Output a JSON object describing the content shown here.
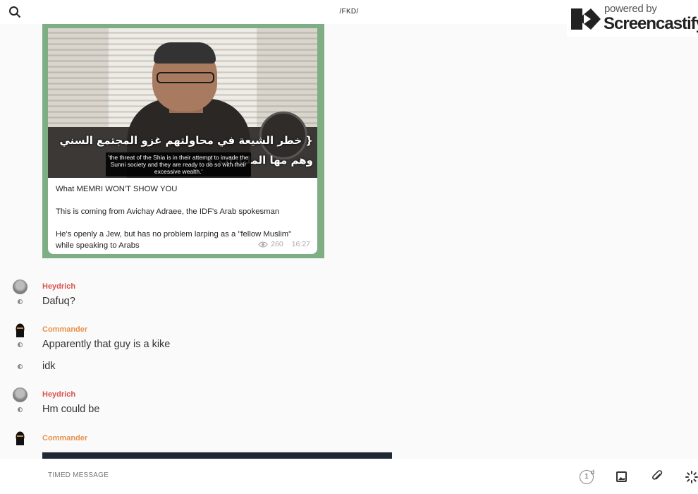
{
  "header": {
    "title": "/FKD/",
    "search_icon": "search-icon",
    "phone_icon": "phone-icon",
    "info_icon": "info-icon"
  },
  "watermark": {
    "powered_by": "powered by",
    "brand": "Screencastify"
  },
  "post": {
    "video": {
      "arabic_line_1": "{ خطر الشيعة في محاولتهم غزو المجتمع السني",
      "arabic_line_2": "وهم مها              المليارات }",
      "english_subtitle": "'the threat of the Shia is in their attempt to invade the Sunni society and they are ready to do so with their excessive wealth.'"
    },
    "paragraphs": [
      "What MEMRI WON'T SHOW YOU",
      "This is coming from Avichay Adraee, the IDF's Arab spokesman",
      "He's openly a Jew, but has no problem larping as a \"fellow Muslim\" while speaking to Arabs"
    ],
    "views": "260",
    "time": "16:27",
    "accent_color": "#7fae84"
  },
  "messages": [
    {
      "sender": "Heydrich",
      "text": "Dafuq?"
    },
    {
      "sender": "Commander",
      "text": "Apparently that guy is a kike"
    },
    {
      "sender": "",
      "text": "idk"
    },
    {
      "sender": "Heydrich",
      "text": "Hm could be"
    },
    {
      "sender": "Commander",
      "text": ""
    }
  ],
  "colors": {
    "heydrich": "#d9534f",
    "commander": "#e8924b"
  },
  "composer": {
    "placeholder": "TIMED MESSAGE",
    "timer_value": "1",
    "timer_unit": "d"
  }
}
